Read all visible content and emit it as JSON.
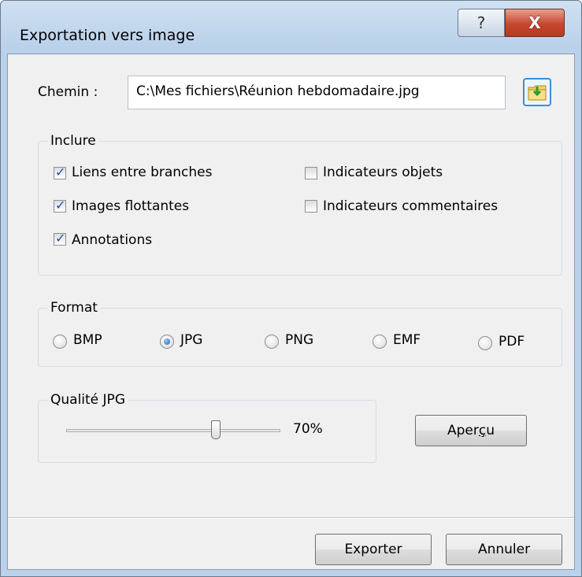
{
  "window": {
    "title": "Exportation vers image",
    "help_glyph": "?",
    "close_glyph": "X",
    "icons": {
      "help": "help-icon",
      "close": "close-icon",
      "browse": "folder-icon"
    }
  },
  "path": {
    "label": "Chemin :",
    "value": "C:\\Mes fichiers\\Réunion hebdomadaire.jpg"
  },
  "include": {
    "legend": "Inclure",
    "items": [
      {
        "label": "Liens entre branches",
        "checked": true
      },
      {
        "label": "Images flottantes",
        "checked": true
      },
      {
        "label": "Annotations",
        "checked": true
      },
      {
        "label": "Indicateurs objets",
        "checked": false
      },
      {
        "label": "Indicateurs commentaires",
        "checked": false
      }
    ]
  },
  "format": {
    "legend": "Format",
    "options": [
      "BMP",
      "JPG",
      "PNG",
      "EMF",
      "PDF"
    ],
    "selected": "JPG"
  },
  "quality": {
    "legend": "Qualité JPG",
    "value_text": "70%",
    "slider_fraction": 0.7
  },
  "buttons": {
    "preview_before": "Aper",
    "preview_u": "ç",
    "preview_after": "u",
    "export": "Exporter",
    "cancel": "Annuler"
  },
  "colors": {
    "title_bar": "#b9d1ea",
    "close_button": "#c6472e",
    "dialog_bg": "#f0f0f0"
  }
}
